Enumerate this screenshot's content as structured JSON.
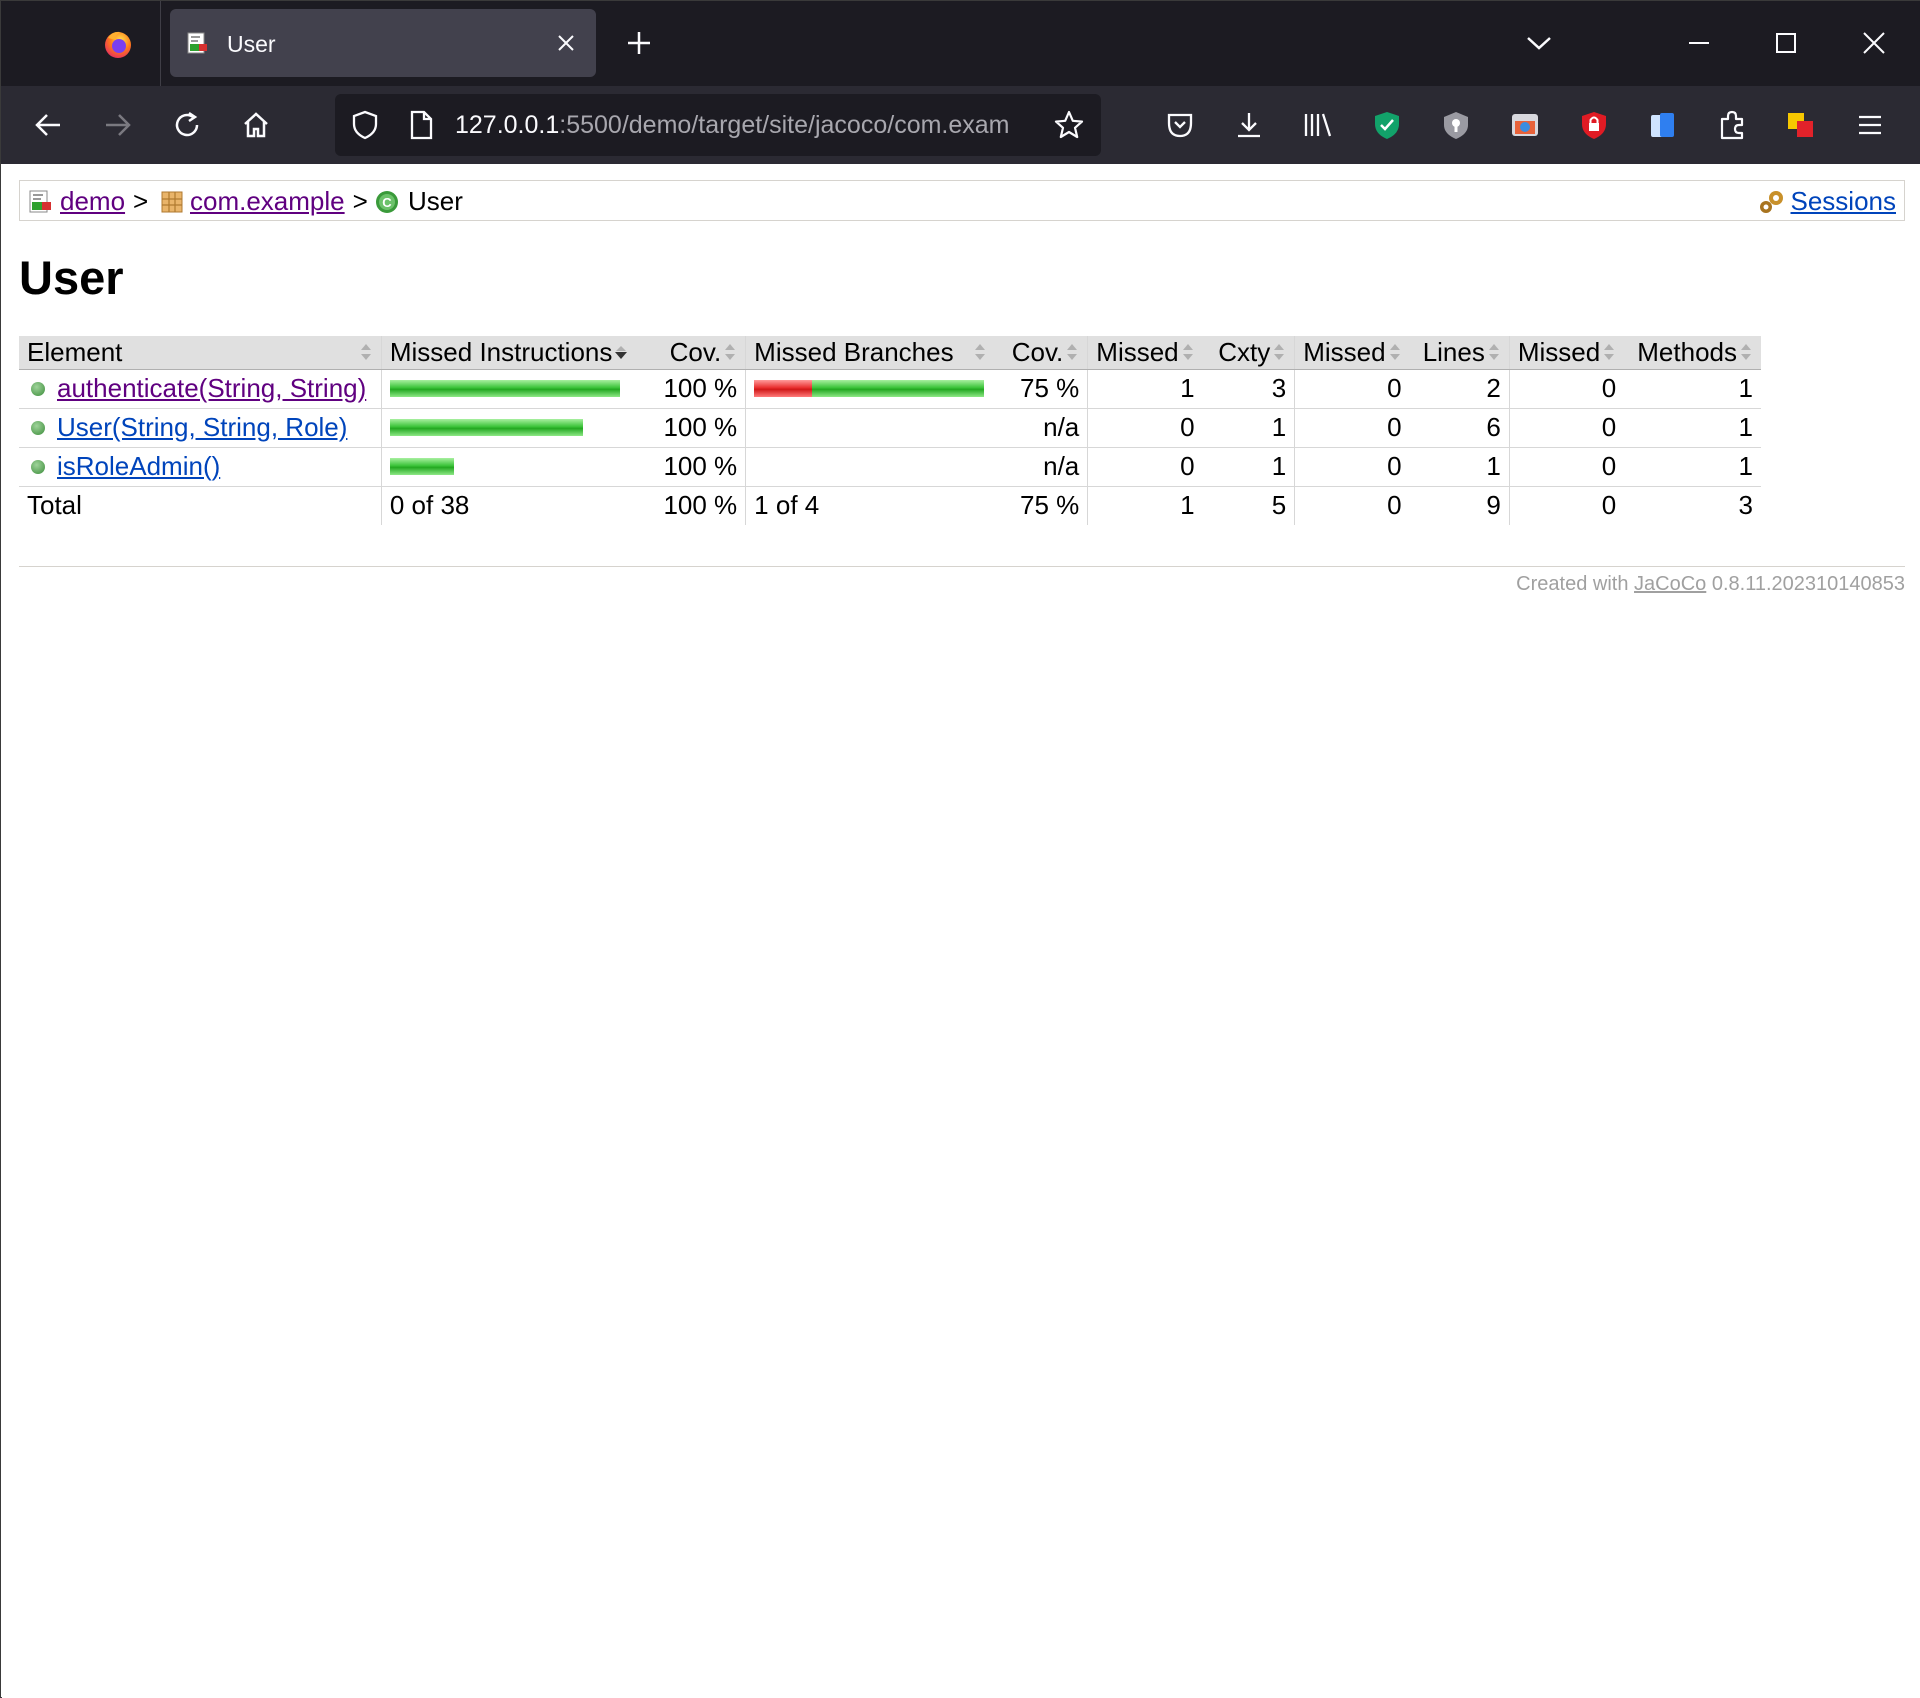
{
  "browser": {
    "tab_title": "User",
    "url_host": "127.0.0.1",
    "url_rest": ":5500/demo/target/site/jacoco/com.exam",
    "icons": {
      "app_menu": "firefox-logo-icon",
      "tab_favicon": "jacoco-report-icon",
      "tab_close": "close-icon",
      "new_tab": "plus-icon",
      "tab_list": "chevron-down-icon",
      "minimize": "minimize-icon",
      "maximize": "maximize-icon",
      "close": "close-icon",
      "back": "back-arrow-icon",
      "forward": "forward-arrow-icon",
      "reload": "reload-icon",
      "home": "home-icon",
      "shield": "shield-icon",
      "page": "page-icon",
      "bookmark": "star-icon",
      "pocket": "pocket-icon",
      "downloads": "download-icon",
      "library": "library-icon",
      "ext_green": "green-shield-extension-icon",
      "ext_gray": "gray-shield-extension-icon",
      "ext_screenshot": "screenshot-extension-icon",
      "ext_red": "red-lock-extension-icon",
      "ext_blue": "blue-cards-extension-icon",
      "extensions": "puzzle-icon",
      "ext_color": "color-squares-extension-icon",
      "menu": "hamburger-menu-icon"
    }
  },
  "breadcrumb": {
    "items": [
      {
        "label": "demo",
        "icon": "report-icon"
      },
      {
        "label": "com.example",
        "icon": "package-icon"
      },
      {
        "label": "User",
        "icon": "class-icon"
      }
    ],
    "separator": ">",
    "sessions_label": "Sessions"
  },
  "page_title": "User",
  "table": {
    "headers": [
      "Element",
      "Missed Instructions",
      "Cov.",
      "Missed Branches",
      "Cov.",
      "Missed",
      "Cxty",
      "Missed",
      "Lines",
      "Missed",
      "Methods"
    ],
    "rows": [
      {
        "element": "authenticate(String, String)",
        "instr_cov": "100 %",
        "branch_cov": "75 %",
        "missed_cxty": "1",
        "cxty": "3",
        "missed_lines": "0",
        "lines": "2",
        "missed_methods": "0",
        "methods": "1",
        "instr_bar": {
          "missed_fraction": 0.0,
          "width_fraction": 1.0
        },
        "branch_bar": {
          "missed_fraction": 0.25,
          "width_fraction": 1.0
        }
      },
      {
        "element": "User(String, String, Role)",
        "instr_cov": "100 %",
        "branch_cov": "n/a",
        "missed_cxty": "0",
        "cxty": "1",
        "missed_lines": "0",
        "lines": "6",
        "missed_methods": "0",
        "methods": "1",
        "instr_bar": {
          "missed_fraction": 0.0,
          "width_fraction": 0.84
        },
        "branch_bar": null
      },
      {
        "element": "isRoleAdmin()",
        "instr_cov": "100 %",
        "branch_cov": "n/a",
        "missed_cxty": "0",
        "cxty": "1",
        "missed_lines": "0",
        "lines": "1",
        "missed_methods": "0",
        "methods": "1",
        "instr_bar": {
          "missed_fraction": 0.0,
          "width_fraction": 0.28
        },
        "branch_bar": null
      }
    ],
    "total": {
      "label": "Total",
      "instr": "0 of 38",
      "instr_cov": "100 %",
      "branch": "1 of 4",
      "branch_cov": "75 %",
      "missed_cxty": "1",
      "cxty": "5",
      "missed_lines": "0",
      "lines": "9",
      "missed_methods": "0",
      "methods": "3"
    },
    "colors": {
      "covered": "#23a821",
      "missed": "#d01818"
    }
  },
  "footer": {
    "prefix": "Created with",
    "link": "JaCoCo",
    "version": "0.8.11.202310140853"
  }
}
